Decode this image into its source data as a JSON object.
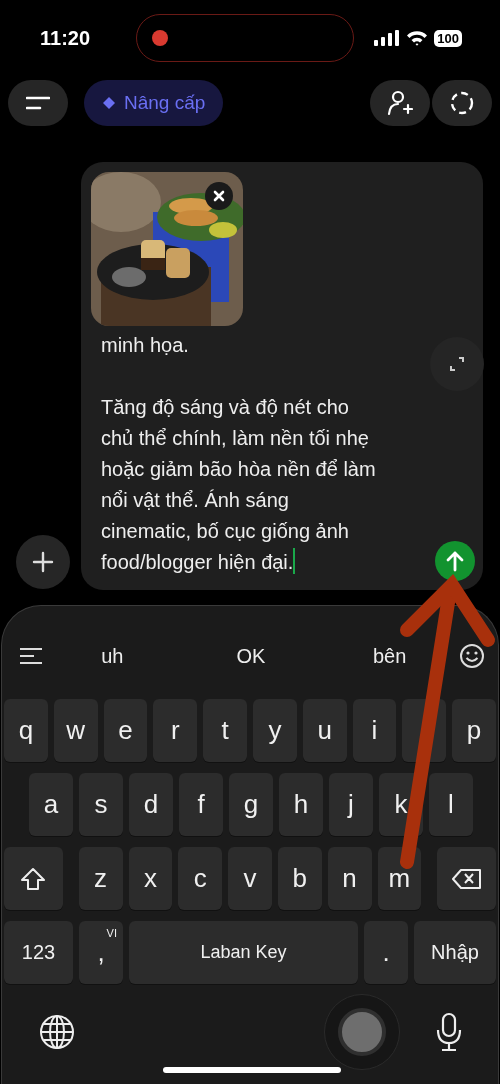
{
  "status_bar": {
    "time": "11:20",
    "battery": "100"
  },
  "top_bar": {
    "upgrade_button": {
      "label": "Nâng cấp"
    }
  },
  "composer": {
    "attachment": {
      "kind": "picture"
    },
    "paragraphs": [
      [
        "minh họa."
      ],
      [
        "Tăng độ sáng và độ nét cho",
        "chủ thể chính, làm nền tối nhẹ",
        "hoặc giảm bão hòa nền để làm",
        "nổi vật thể. Ánh sáng",
        "cinematic, bố cục giống ảnh",
        "food/blogger hiện đại."
      ]
    ]
  },
  "keyboard": {
    "suggestions": [
      "uh",
      "OK",
      "bên"
    ],
    "rows": [
      {
        "keys": [
          {
            "kind": "letter",
            "label": "q"
          },
          {
            "kind": "letter",
            "label": "w"
          },
          {
            "kind": "letter",
            "label": "e"
          },
          {
            "kind": "letter",
            "label": "r"
          },
          {
            "kind": "letter",
            "label": "t"
          },
          {
            "kind": "letter",
            "label": "y"
          },
          {
            "kind": "letter",
            "label": "u"
          },
          {
            "kind": "letter",
            "label": "i"
          },
          {
            "kind": "blank"
          },
          {
            "kind": "letter",
            "label": "p"
          }
        ]
      },
      {
        "keys": [
          {
            "kind": "letter",
            "label": "a"
          },
          {
            "kind": "letter",
            "label": "s"
          },
          {
            "kind": "letter",
            "label": "d"
          },
          {
            "kind": "letter",
            "label": "f"
          },
          {
            "kind": "letter",
            "label": "g"
          },
          {
            "kind": "letter",
            "label": "h"
          },
          {
            "kind": "letter",
            "label": "j"
          },
          {
            "kind": "letter",
            "label": "k"
          },
          {
            "kind": "letter",
            "label": "l"
          }
        ]
      },
      {
        "keys": [
          {
            "kind": "shift"
          },
          {
            "kind": "letter",
            "label": "z"
          },
          {
            "kind": "letter",
            "label": "x"
          },
          {
            "kind": "letter",
            "label": "c"
          },
          {
            "kind": "letter",
            "label": "v"
          },
          {
            "kind": "letter",
            "label": "b"
          },
          {
            "kind": "letter",
            "label": "n"
          },
          {
            "kind": "letter",
            "label": "m"
          },
          {
            "kind": "backspace"
          }
        ]
      },
      {
        "keys": [
          {
            "kind": "numbers",
            "label": "123"
          },
          {
            "kind": "comma",
            "label": ",",
            "hint": "VI"
          },
          {
            "kind": "space",
            "label": "Laban Key"
          },
          {
            "kind": "period",
            "label": "."
          },
          {
            "kind": "enter",
            "label": "Nhập"
          }
        ]
      }
    ]
  }
}
